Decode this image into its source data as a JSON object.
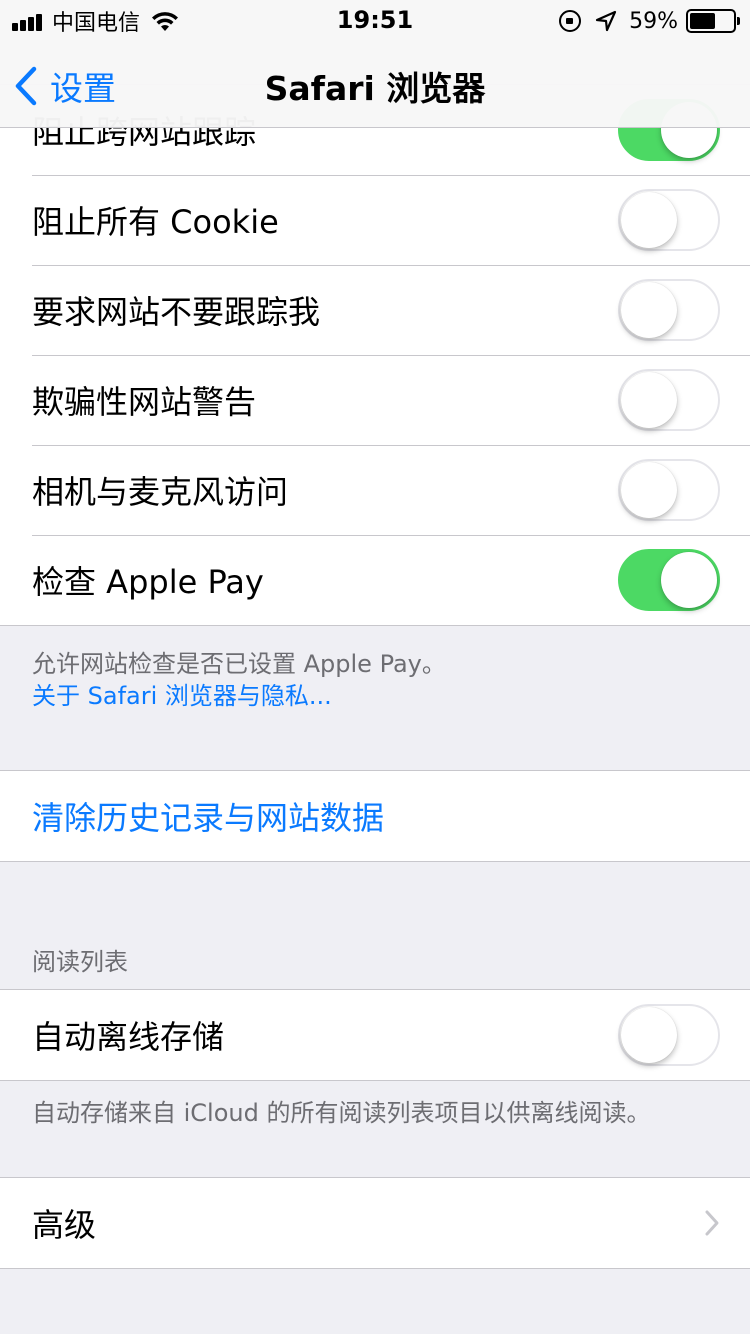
{
  "status_bar": {
    "carrier": "中国电信",
    "time": "19:51",
    "battery_percent": "59%",
    "battery_level": 0.59,
    "icons": [
      "signal-icon",
      "wifi-icon",
      "rotation-lock-icon",
      "location-icon",
      "battery-icon"
    ]
  },
  "nav": {
    "back_label": "设置",
    "title": "Safari 浏览器"
  },
  "privacy_rows": [
    {
      "label": "阻止跨网站跟踪",
      "on": true
    },
    {
      "label": "阻止所有 Cookie",
      "on": false
    },
    {
      "label": "要求网站不要跟踪我",
      "on": false
    },
    {
      "label": "欺骗性网站警告",
      "on": false
    },
    {
      "label": "相机与麦克风访问",
      "on": false
    },
    {
      "label": "检查 Apple Pay",
      "on": true
    }
  ],
  "privacy_footer": {
    "text": "允许网站检查是否已设置 Apple Pay。",
    "link": "关于 Safari 浏览器与隐私..."
  },
  "clear_history": {
    "label": "清除历史记录与网站数据"
  },
  "reading_list": {
    "header": "阅读列表",
    "auto_save_label": "自动离线存储",
    "auto_save_on": false,
    "footer": "自动存储来自 iCloud 的所有阅读列表项目以供离线阅读。"
  },
  "advanced": {
    "label": "高级"
  },
  "colors": {
    "accent": "#0a7aff",
    "toggle_on": "#4cd964",
    "background": "#efeff4"
  }
}
